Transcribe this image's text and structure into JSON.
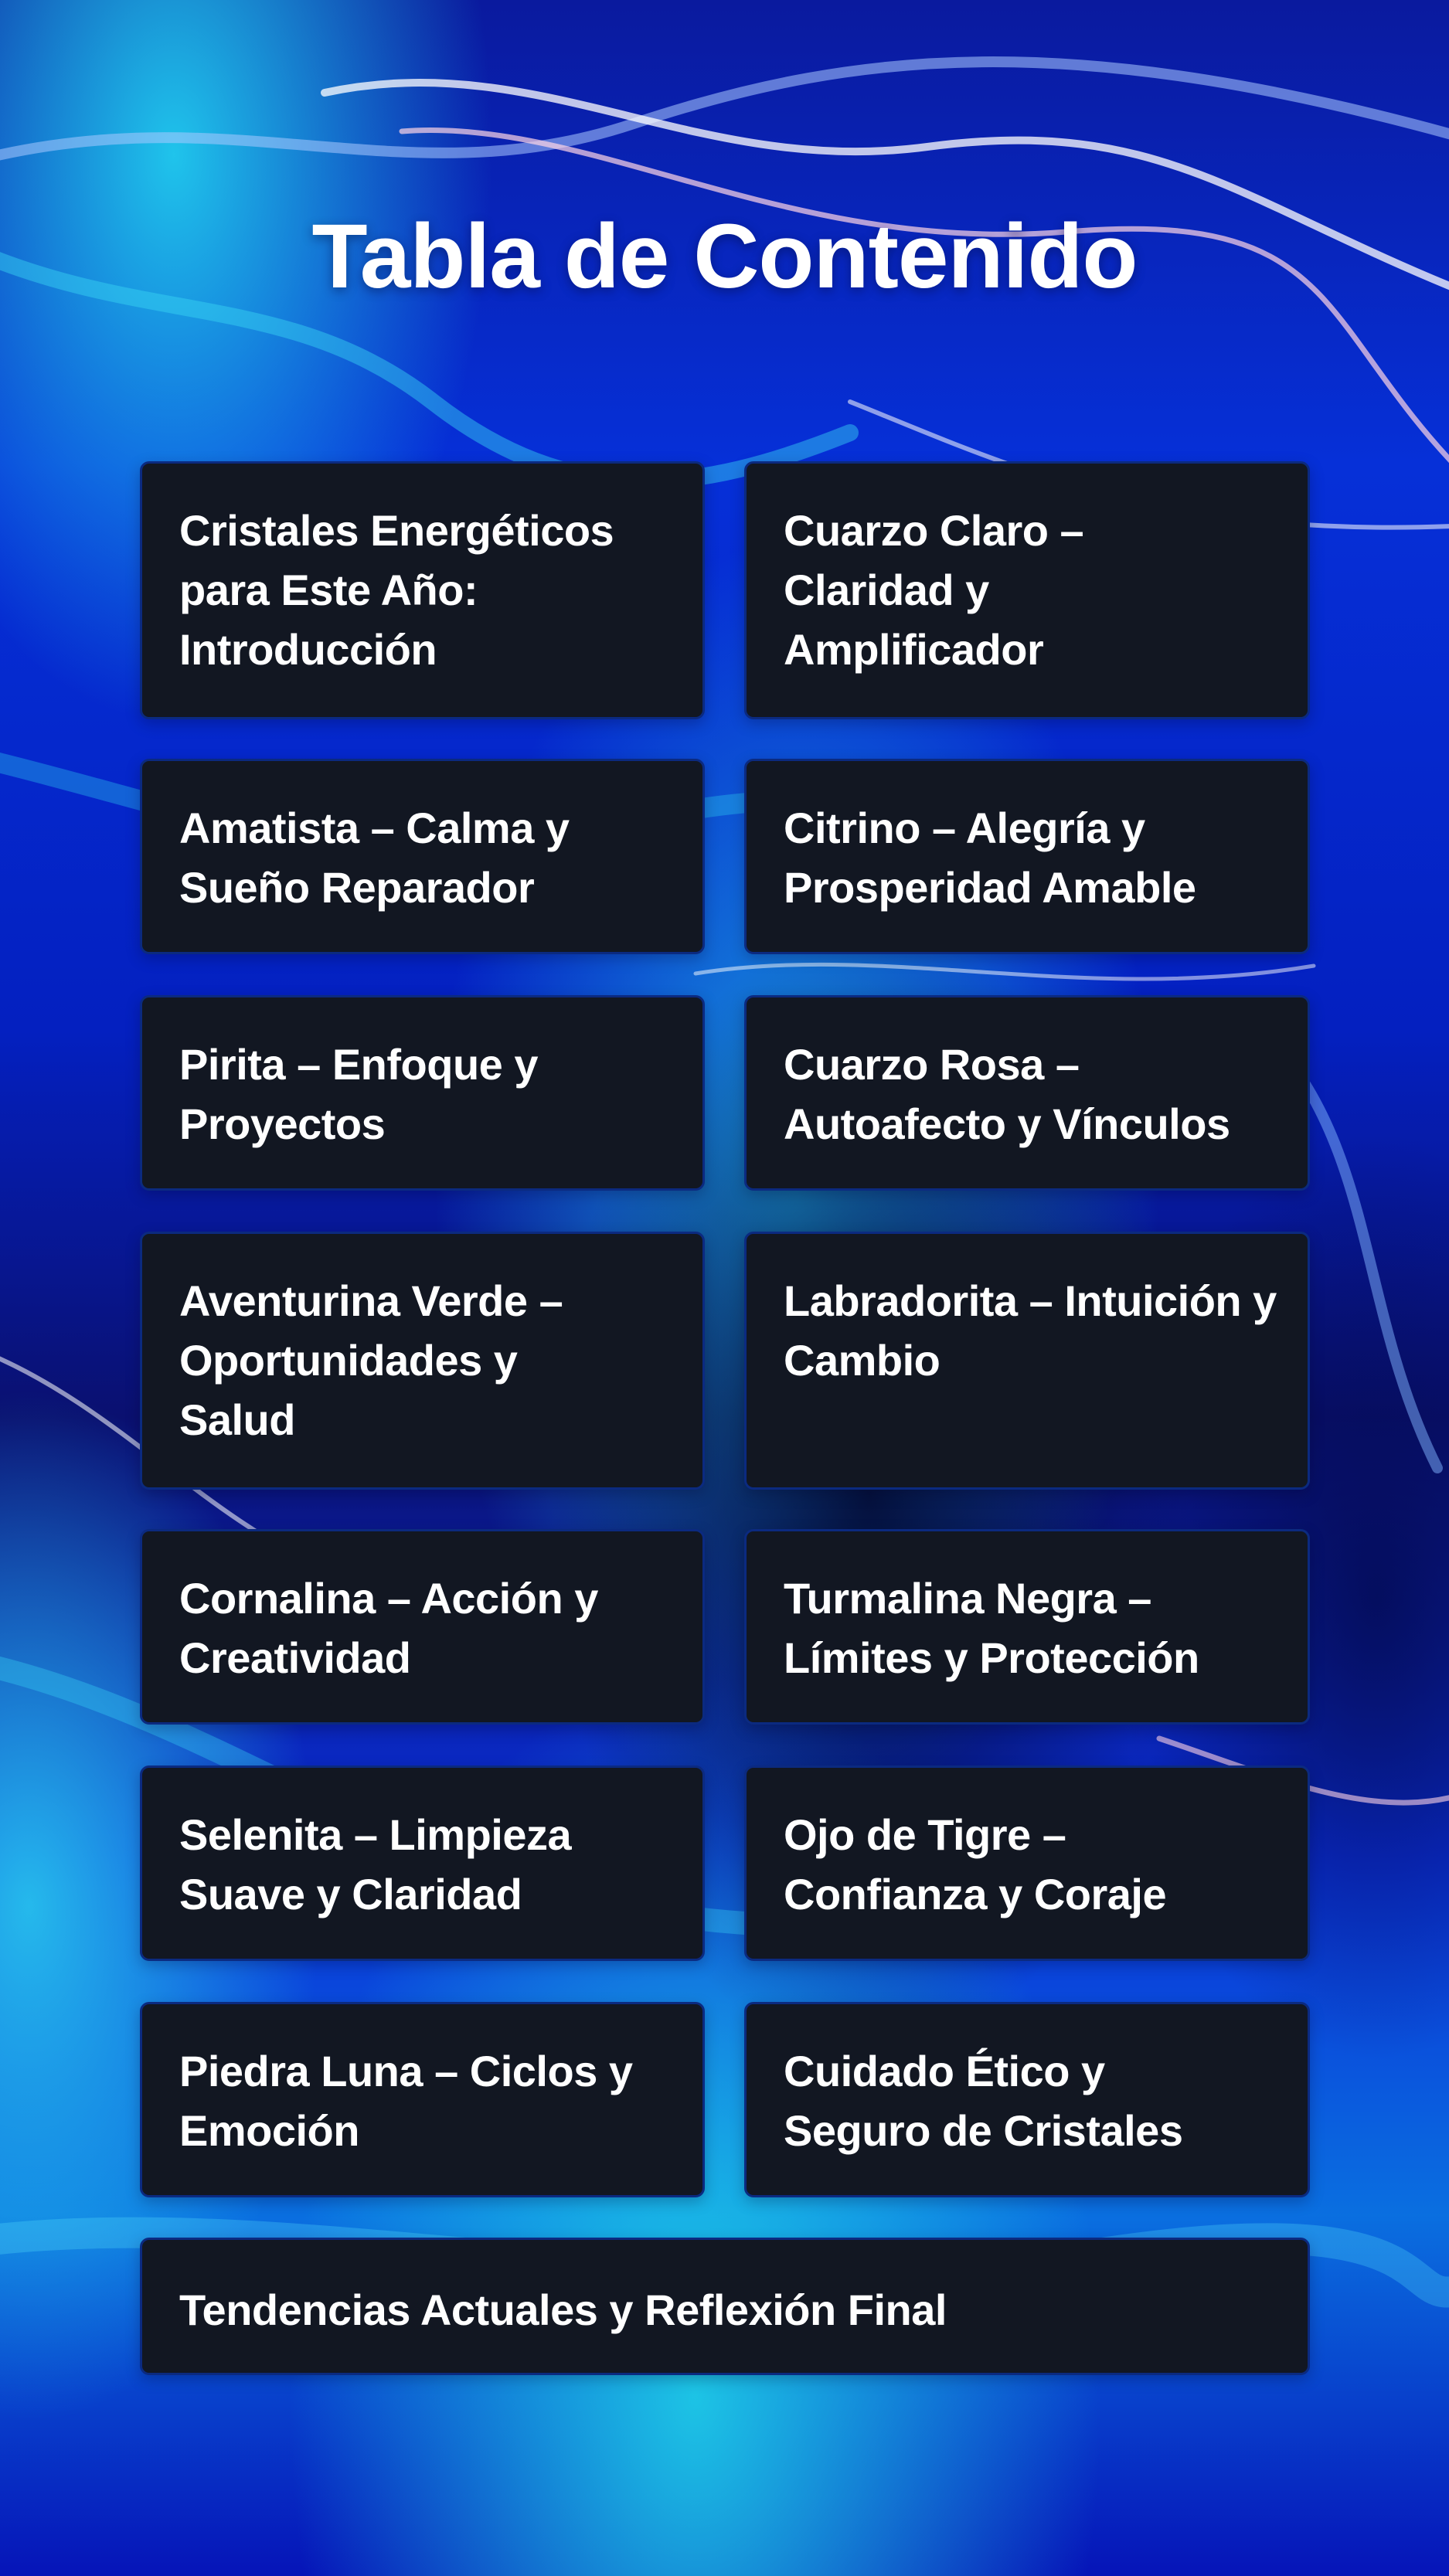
{
  "title": "Tabla de Contenido",
  "colors": {
    "background_primary": "#0418b8",
    "background_highlight": "#1fd2e8",
    "card_background": "#121722",
    "card_border": "#0b2a80",
    "text": "#ffffff"
  },
  "toc": {
    "items": [
      {
        "label": "Cristales Energéticos para Este Año: Introducción"
      },
      {
        "label": "Cuarzo Claro – Claridad y Amplificador"
      },
      {
        "label": "Amatista – Calma y Sueño Reparador"
      },
      {
        "label": "Citrino – Alegría y Prosperidad Amable"
      },
      {
        "label": "Pirita – Enfoque y Proyectos"
      },
      {
        "label": "Cuarzo Rosa – Autoafecto y Vínculos"
      },
      {
        "label": "Aventurina Verde – Oportunidades y Salud"
      },
      {
        "label": "Labradorita – Intuición y Cambio"
      },
      {
        "label": "Cornalina – Acción y Creatividad"
      },
      {
        "label": "Turmalina Negra – Límites y Protección"
      },
      {
        "label": "Selenita – Limpieza Suave y Claridad"
      },
      {
        "label": "Ojo de Tigre – Confianza y Coraje"
      },
      {
        "label": "Piedra Luna – Ciclos y Emoción"
      },
      {
        "label": "Cuidado Ético y Seguro de Cristales"
      },
      {
        "label": "Tendencias Actuales y Reflexión Final"
      }
    ]
  }
}
